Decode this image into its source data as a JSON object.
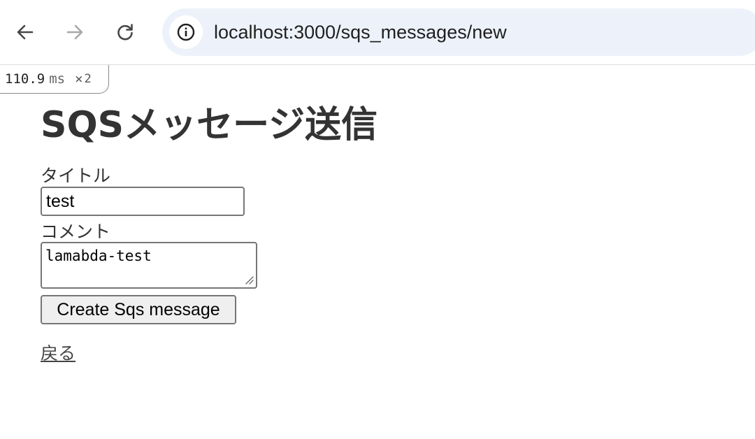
{
  "browser": {
    "url": "localhost:3000/sqs_messages/new",
    "icons": {
      "back": "arrow-left-icon",
      "forward": "arrow-right-icon",
      "reload": "reload-icon",
      "info": "info-icon"
    }
  },
  "perf_badge": {
    "value": "110.9",
    "unit": "ms",
    "times": "×",
    "count": "2"
  },
  "page": {
    "title": "SQSメッセージ送信",
    "form": {
      "title_label": "タイトル",
      "title_value": "test",
      "comment_label": "コメント",
      "comment_value": "lamabda-test",
      "submit_label": "Create Sqs message"
    },
    "back_link": "戻る"
  }
}
